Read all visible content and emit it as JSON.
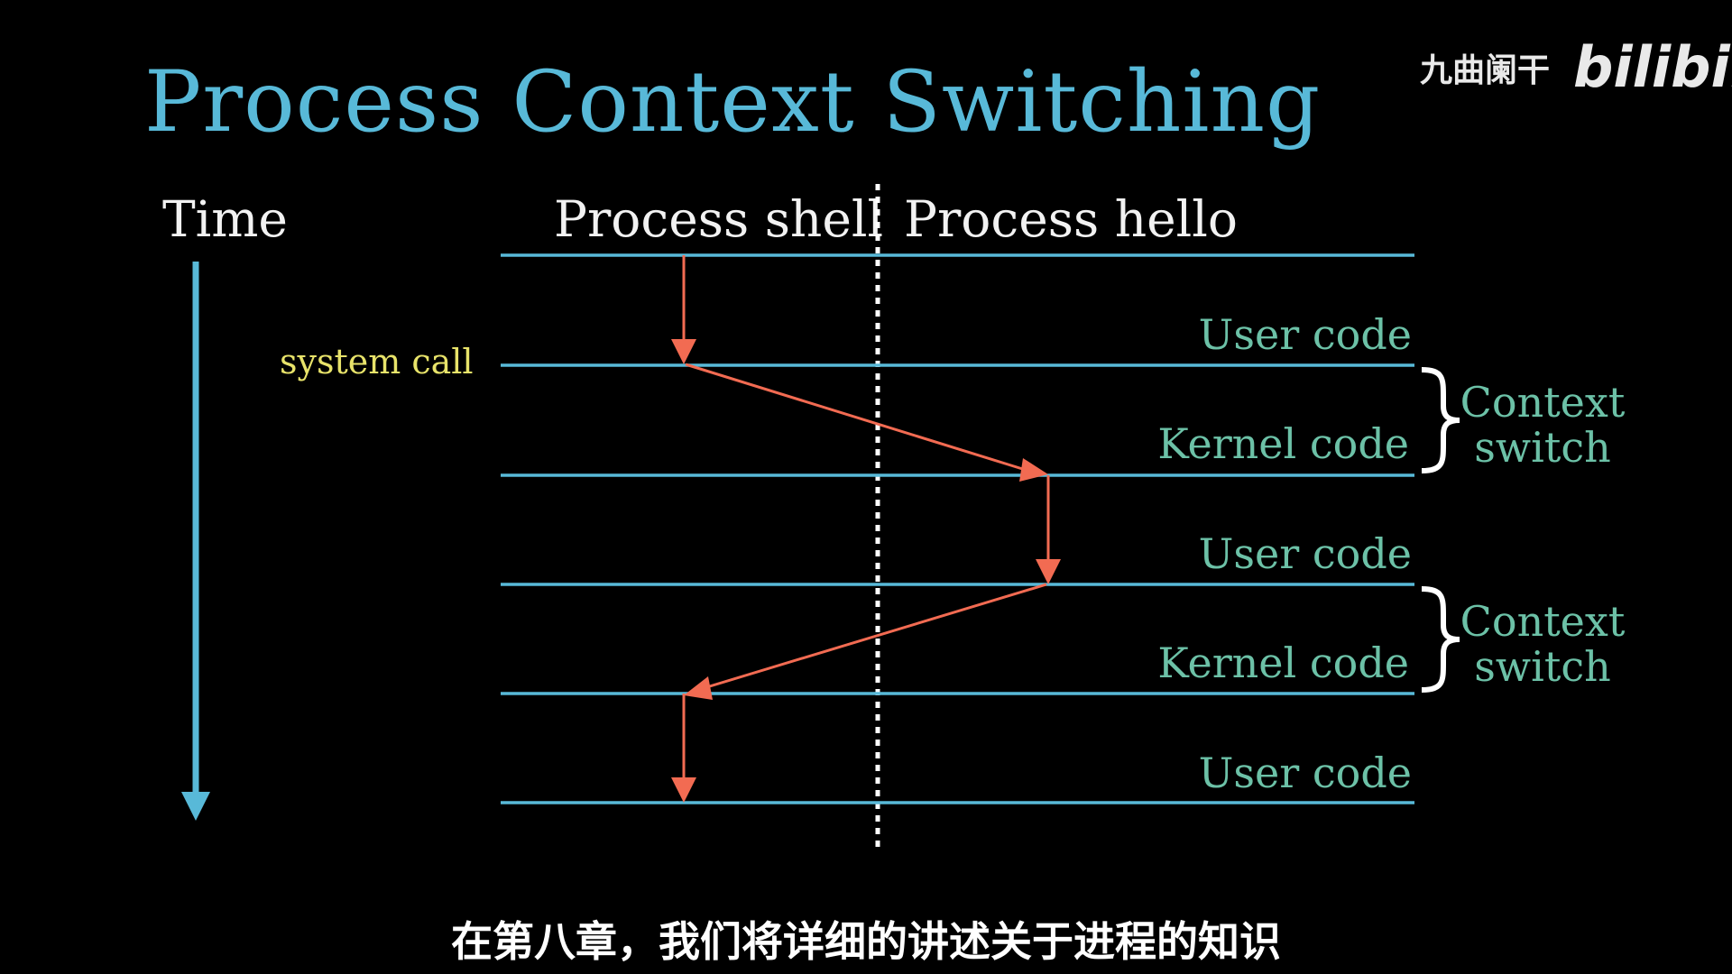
{
  "title": "Process Context Switching",
  "watermark": {
    "channel": "九曲阑干",
    "brand": "bilibili"
  },
  "diagram": {
    "time_label": "Time",
    "columns": [
      "Process shell",
      "Process hello"
    ],
    "event_label": "system call",
    "rows": [
      "User code",
      "Kernel code",
      "User code",
      "Kernel code",
      "User code"
    ],
    "brace_labels": [
      {
        "line1": "Context",
        "line2": "switch"
      },
      {
        "line1": "Context",
        "line2": "switch"
      }
    ]
  },
  "colors": {
    "background": "#000000",
    "title": "#58b9d8",
    "lines": "#58b9d8",
    "arrows": "#f26b52",
    "code_labels": "#6cc1a7",
    "system_call": "#e8e36a"
  },
  "subtitle": "在第八章，我们将详细的讲述关于进程的知识"
}
